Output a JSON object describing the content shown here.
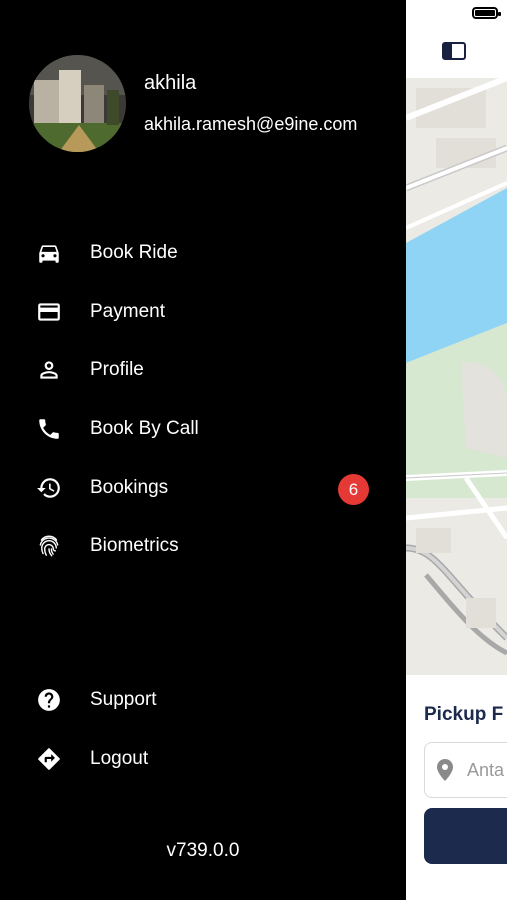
{
  "drawer": {
    "user": {
      "name": "akhila",
      "email": "akhila.ramesh@e9ine.com"
    },
    "menu": [
      {
        "label": "Book Ride",
        "icon": "car-icon"
      },
      {
        "label": "Payment",
        "icon": "credit-card-icon"
      },
      {
        "label": "Profile",
        "icon": "person-icon"
      },
      {
        "label": "Book By Call",
        "icon": "phone-icon"
      },
      {
        "label": "Bookings",
        "icon": "history-icon",
        "badge": "6"
      },
      {
        "label": "Biometrics",
        "icon": "fingerprint-icon"
      }
    ],
    "footer_menu": [
      {
        "label": "Support",
        "icon": "help-icon"
      },
      {
        "label": "Logout",
        "icon": "logout-icon"
      }
    ],
    "version": "v739.0.0"
  },
  "main": {
    "pickup_title": "Pickup F",
    "pickup_field_value": "Anta"
  },
  "colors": {
    "drawer_bg": "#000000",
    "badge": "#e53935",
    "brand_navy": "#1c2a4d",
    "water": "#8fd4f5",
    "park": "#d6e8cf"
  }
}
